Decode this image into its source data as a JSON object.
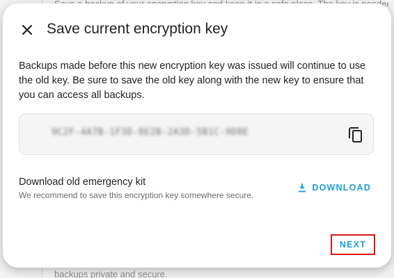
{
  "background": {
    "top_text": "Save a backup of your encryption key and keep it in a safe place. The key is needed to restore",
    "bottom_text": "backups private and secure."
  },
  "dialog": {
    "title": "Save current encryption key",
    "close_icon": "close-icon",
    "description": "Backups made before this new encryption key was issued will continue to use the old key. Be sure to save the old key along with the new key to ensure that you can access all backups.",
    "key": {
      "value": "9C2F-4A7B-1F3D-8E2B-2A3D-5B1C-9D8E",
      "copy_icon": "copy-icon"
    },
    "download": {
      "title": "Download old emergency kit",
      "subtitle": "We recommend to save this encryption key somewhere secure.",
      "button_label": "DOWNLOAD",
      "button_icon": "download-icon"
    },
    "next_label": "NEXT"
  },
  "colors": {
    "accent": "#1e9ed6",
    "highlight_border": "#d51a1a",
    "title_text": "#212121",
    "secondary_text": "#6b6b6b"
  }
}
